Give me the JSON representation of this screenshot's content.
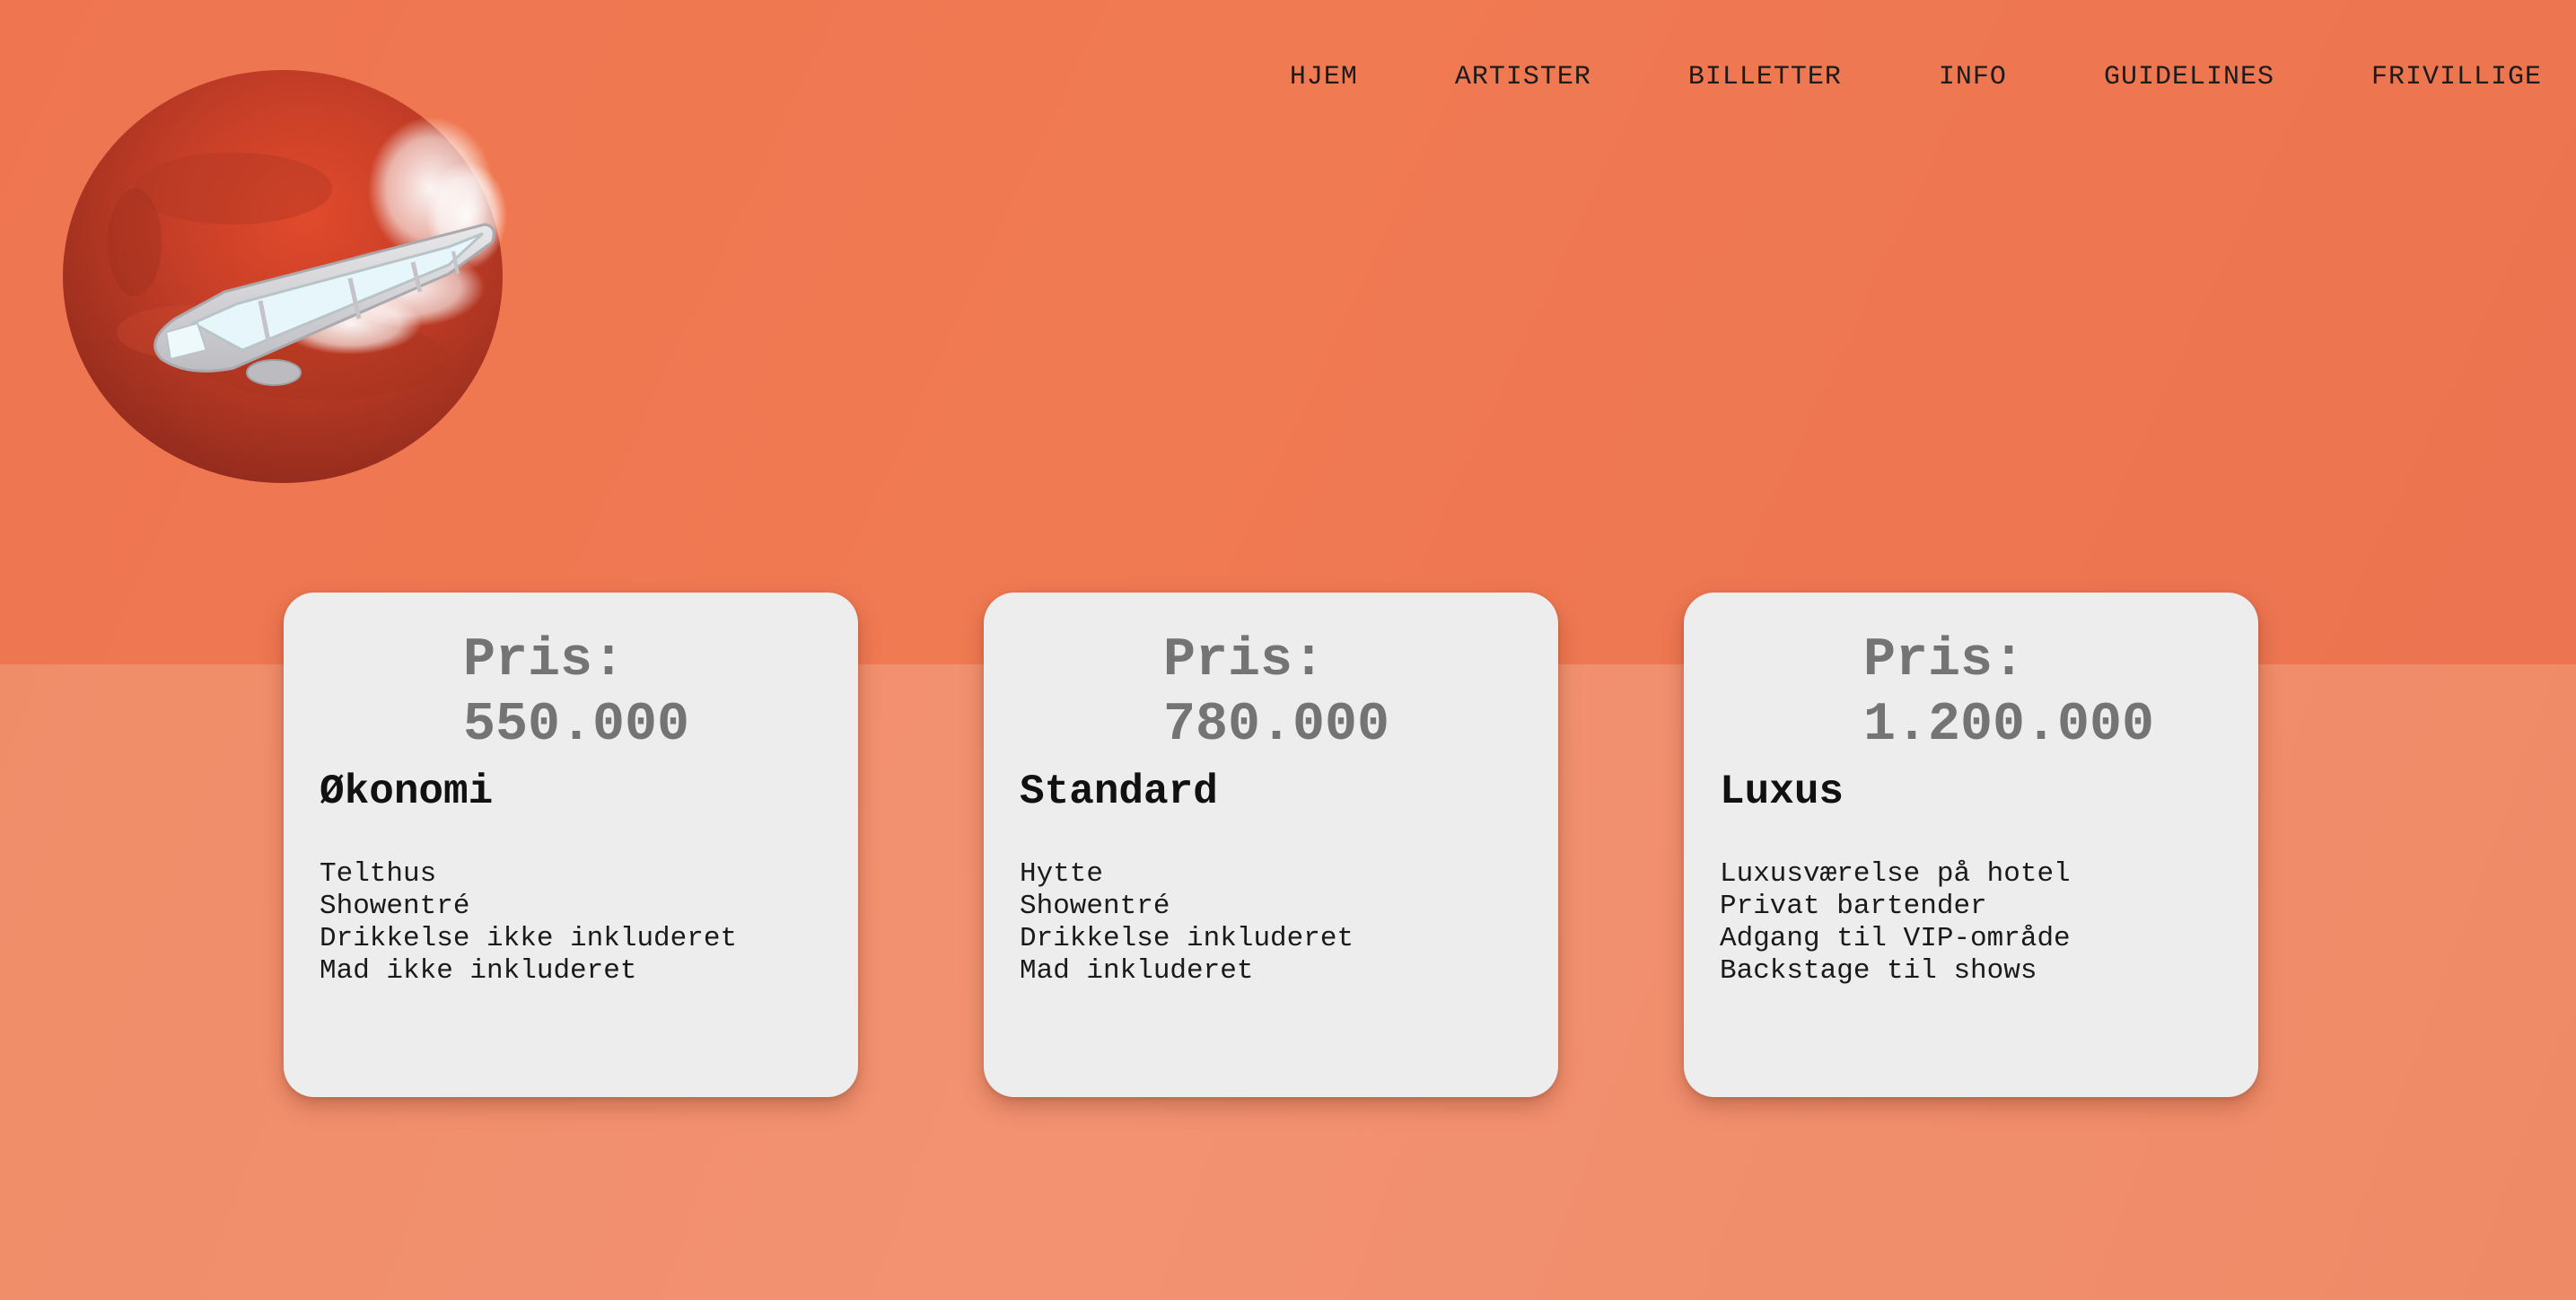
{
  "nav": {
    "items": [
      {
        "label": "HJEM"
      },
      {
        "label": "ARTISTER"
      },
      {
        "label": "BILLETTER"
      },
      {
        "label": "INFO"
      },
      {
        "label": "GUIDELINES"
      },
      {
        "label": "FRIVILLIGE"
      }
    ]
  },
  "logo": {
    "icon": "planet-spaceship-logo"
  },
  "colors": {
    "background_top": "#ef7651",
    "background_bottom": "#f18e6b",
    "card_background": "#ededed",
    "price_text": "#747474",
    "planet": "#c7402a"
  },
  "tickets": [
    {
      "price_label": "Pris:",
      "price_value": "550.000",
      "name": "Økonomi",
      "features": [
        "Telthus",
        "Showentré",
        "Drikkelse ikke inkluderet",
        "Mad ikke inkluderet"
      ]
    },
    {
      "price_label": "Pris:",
      "price_value": "780.000",
      "name": "Standard",
      "features": [
        "Hytte",
        "Showentré",
        "Drikkelse inkluderet",
        "Mad inkluderet"
      ]
    },
    {
      "price_label": "Pris:",
      "price_value": "1.200.000",
      "name": "Luxus",
      "features": [
        "Luxusværelse på hotel",
        "Privat bartender",
        "Adgang til VIP-område",
        "Backstage til shows"
      ]
    }
  ]
}
